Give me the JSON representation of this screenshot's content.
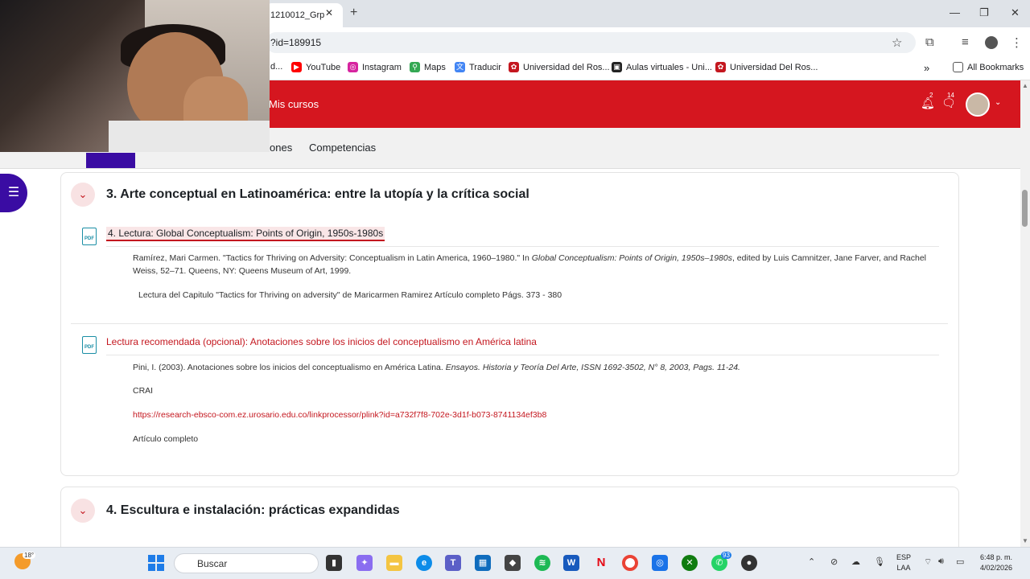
{
  "browser": {
    "tab_title": "1210012_Grp",
    "tab_close": "✕",
    "new_tab": "+",
    "url": "?id=189915",
    "bookmarks": [
      {
        "label": "d...",
        "icon": "doc-icon",
        "color": "#4a4a4a"
      },
      {
        "label": "YouTube",
        "icon": "youtube-icon",
        "color": "#ff0000"
      },
      {
        "label": "Instagram",
        "icon": "instagram-icon",
        "color": "#d6249f"
      },
      {
        "label": "Maps",
        "icon": "maps-icon",
        "color": "#34a853"
      },
      {
        "label": "Traducir",
        "icon": "translate-icon",
        "color": "#4285f4"
      },
      {
        "label": "Universidad del Ros...",
        "icon": "university-icon",
        "color": "#c4171f"
      },
      {
        "label": "Aulas virtuales - Uni...",
        "icon": "moodle-icon",
        "color": "#222222"
      },
      {
        "label": "Universidad Del Ros...",
        "icon": "university-icon",
        "color": "#c4171f"
      }
    ],
    "more_bookmarks": "»",
    "all_bookmarks": "All Bookmarks"
  },
  "header": {
    "nav_label": "Mis cursos",
    "notifications_count": "2",
    "messages_count": "14"
  },
  "subnav": {
    "tabs": [
      "ones",
      "Competencias"
    ]
  },
  "sections": [
    {
      "title": "3. Arte conceptual en Latinoamérica: entre la utopía y la crítica social",
      "activities": [
        {
          "title": "4. Lectura: Global Conceptualism: Points of Origin, 1950s-1980s",
          "citation_pre": "Ramírez, Mari Carmen. \"Tactics for Thriving on Adversity: Conceptualism in Latin America, 1960–1980.\" In ",
          "citation_em": "Global Conceptualism: Points of Origin, 1950s–1980s",
          "citation_post": ", edited by Luis Camnitzer, Jane Farver, and Rachel Weiss, 52–71. Queens, NY: Queens Museum of Art, 1999.",
          "note": "Lectura del Capitulo \"Tactics for Thriving on adversity\" de Maricarmen Ramirez Artículo completo Págs. 373 - 380"
        },
        {
          "title": "Lectura recomendada (opcional): Anotaciones sobre los inicios del conceptualismo en América latina",
          "citation_pre": "Pini, I. (2003). Anotaciones sobre los inicios del conceptualismo en América Latina. ",
          "citation_em": "Ensayos. Historia y Teoría Del Arte, ISSN 1692-3502, N° 8, 2003, Pags. 11-24.",
          "crai": "CRAI",
          "link": "https://research-ebsco-com.ez.urosario.edu.co/linkprocessor/plink?id=a732f7f8-702e-3d1f-b073-8741134ef3b8",
          "full_article": "Artículo completo"
        }
      ]
    },
    {
      "title": "4. Escultura e instalación: prácticas expandidas"
    }
  ],
  "taskbar": {
    "weather_temp": "18°",
    "search_placeholder": "Buscar",
    "whatsapp_badge": "93",
    "language": "ESP",
    "keyboard": "LAA",
    "time": "6:48 p. m.",
    "date": "4/02/2026"
  }
}
